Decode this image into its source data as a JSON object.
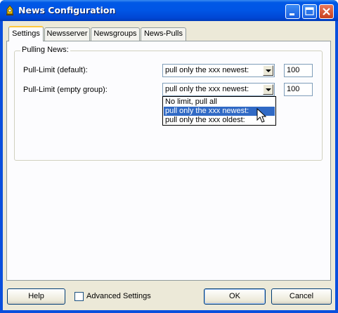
{
  "window": {
    "title": "News Configuration",
    "accent": "#0055e5"
  },
  "tabs": [
    {
      "label": "Settings",
      "active": true
    },
    {
      "label": "Newsserver",
      "active": false
    },
    {
      "label": "Newsgroups",
      "active": false
    },
    {
      "label": "News-Pulls",
      "active": false
    }
  ],
  "group": {
    "legend": "Pulling News:"
  },
  "rows": [
    {
      "label": "Pull-Limit (default):",
      "mode": "pull only the xxx newest:",
      "limit": "100"
    },
    {
      "label": "Pull-Limit (empty group):",
      "mode": "pull only the xxx newest:",
      "limit": "100"
    }
  ],
  "dropdown": {
    "options": [
      "No limit, pull all",
      "pull only the xxx newest:",
      "pull only the xxx oldest:"
    ],
    "selected_index": 1
  },
  "footer": {
    "help": "Help",
    "advanced": "Advanced Settings",
    "advanced_checked": false,
    "ok": "OK",
    "cancel": "Cancel"
  }
}
